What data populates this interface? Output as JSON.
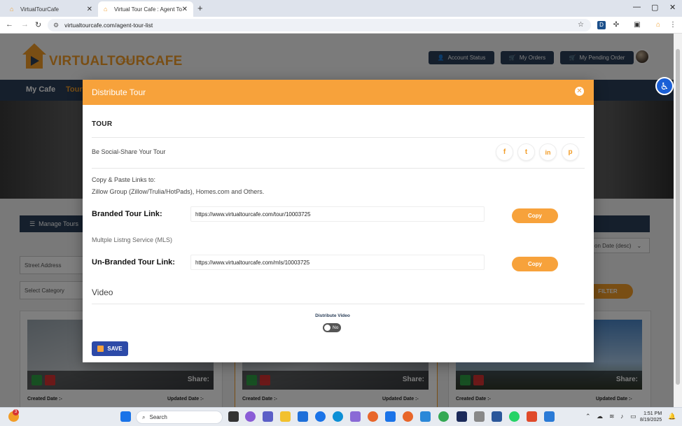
{
  "browser": {
    "tabs": [
      {
        "title": "VirtualTourCafe",
        "active": false
      },
      {
        "title": "Virtual Tour Cafe : Agent Tour L",
        "active": true
      }
    ],
    "url": "virtualtourcafe.com/agent-tour-list"
  },
  "site": {
    "logo_text": "VIRTUALTOURCAFE",
    "logo_sub": ".COM",
    "header_buttons": [
      "Account Status",
      "My Orders",
      "My Pending Order"
    ],
    "nav": [
      "My Cafe",
      "Tour"
    ],
    "manage_label": "Manage Tours",
    "street_placeholder": "Street Address",
    "category_placeholder": "Select Category",
    "sort_value": "on Date (desc)",
    "filter_label": "FILTER",
    "share_label": "Share:",
    "created_label": "Created Date :-",
    "updated_label": "Updated Date :-"
  },
  "modal": {
    "title": "Distribute Tour",
    "section_title": "TOUR",
    "social_label": "Be Social-Share Your Tour",
    "social_icons": [
      "facebook-icon",
      "twitter-icon",
      "linkedin-icon",
      "pinterest-icon"
    ],
    "social_glyphs": [
      "f",
      "t",
      "in",
      "p"
    ],
    "copy_paste_label": "Copy & Paste Links to:",
    "copy_paste_targets": "Zillow Group (Zillow/Trulia/HotPads), Homes.com and Others.",
    "branded_label": "Branded Tour Link:",
    "branded_url": "https://www.virtualtourcafe.com/tour/10003725",
    "mls_label": "Multple Listng Service (MLS)",
    "unbranded_label": "Un-Branded Tour Link:",
    "unbranded_url": "https://www.virtualtourcafe.com/mls/10003725",
    "copy_label": "Copy",
    "video_title": "Video",
    "distribute_video_label": "Distribute Video",
    "toggle_value": "No",
    "save_label": "SAVE"
  },
  "taskbar": {
    "search_placeholder": "Search",
    "time": "1:51 PM",
    "date": "8/19/2025",
    "badge": "3"
  },
  "colors": {
    "accent": "#f7a23b",
    "navy": "#2a3e58",
    "save": "#2d4aa8"
  }
}
